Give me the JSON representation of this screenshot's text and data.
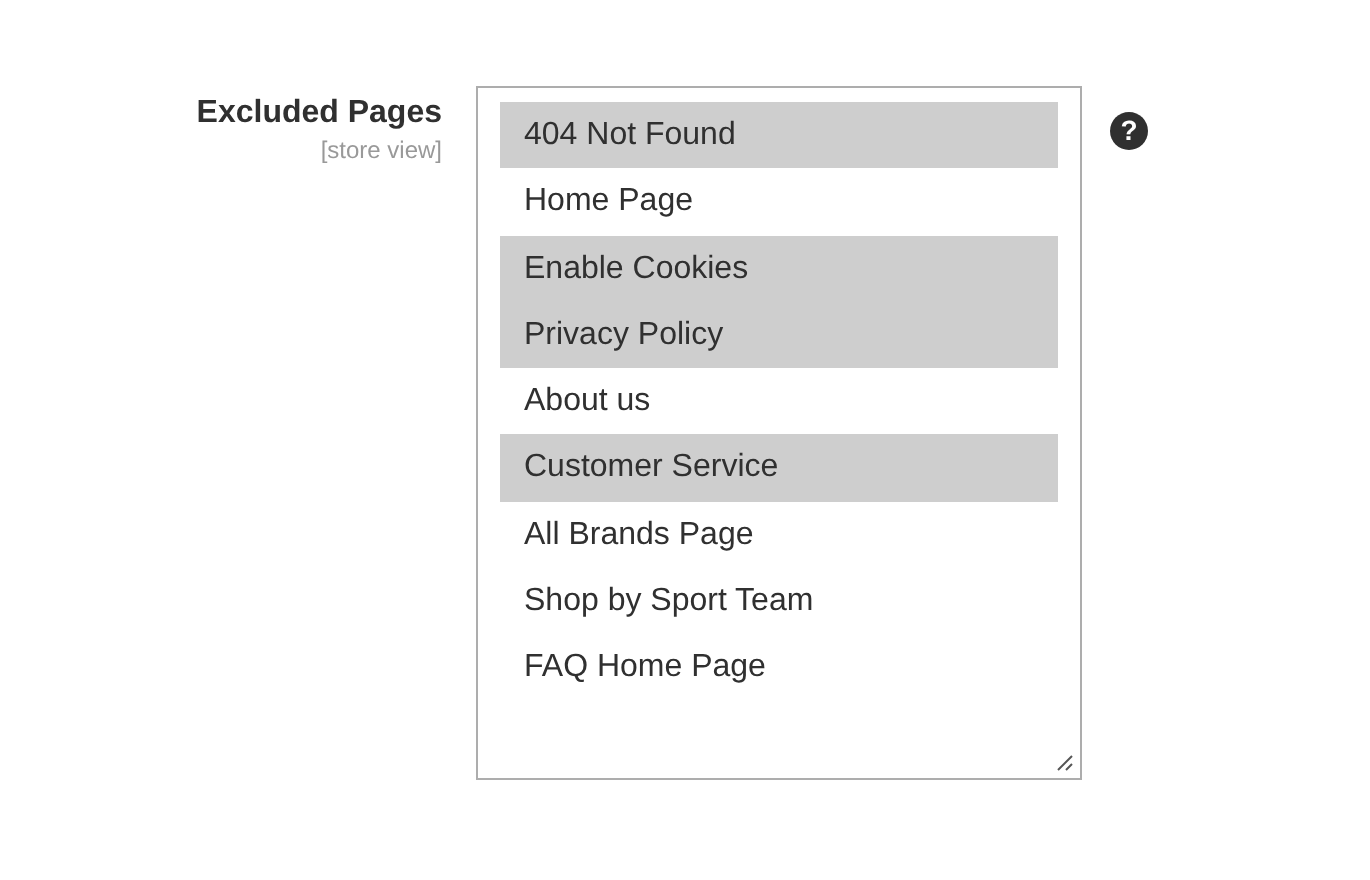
{
  "field": {
    "label": "Excluded Pages",
    "scope": "[store view]",
    "options": [
      {
        "label": "404 Not Found",
        "selected": true
      },
      {
        "label": "Home Page",
        "selected": false
      },
      {
        "label": "Enable Cookies",
        "selected": true
      },
      {
        "label": "Privacy Policy",
        "selected": true
      },
      {
        "label": "About us",
        "selected": false
      },
      {
        "label": "Customer Service",
        "selected": true
      },
      {
        "label": "All Brands Page",
        "selected": false
      },
      {
        "label": "Shop by Sport Team",
        "selected": false
      },
      {
        "label": "FAQ Home Page",
        "selected": false
      }
    ],
    "help": "?"
  }
}
